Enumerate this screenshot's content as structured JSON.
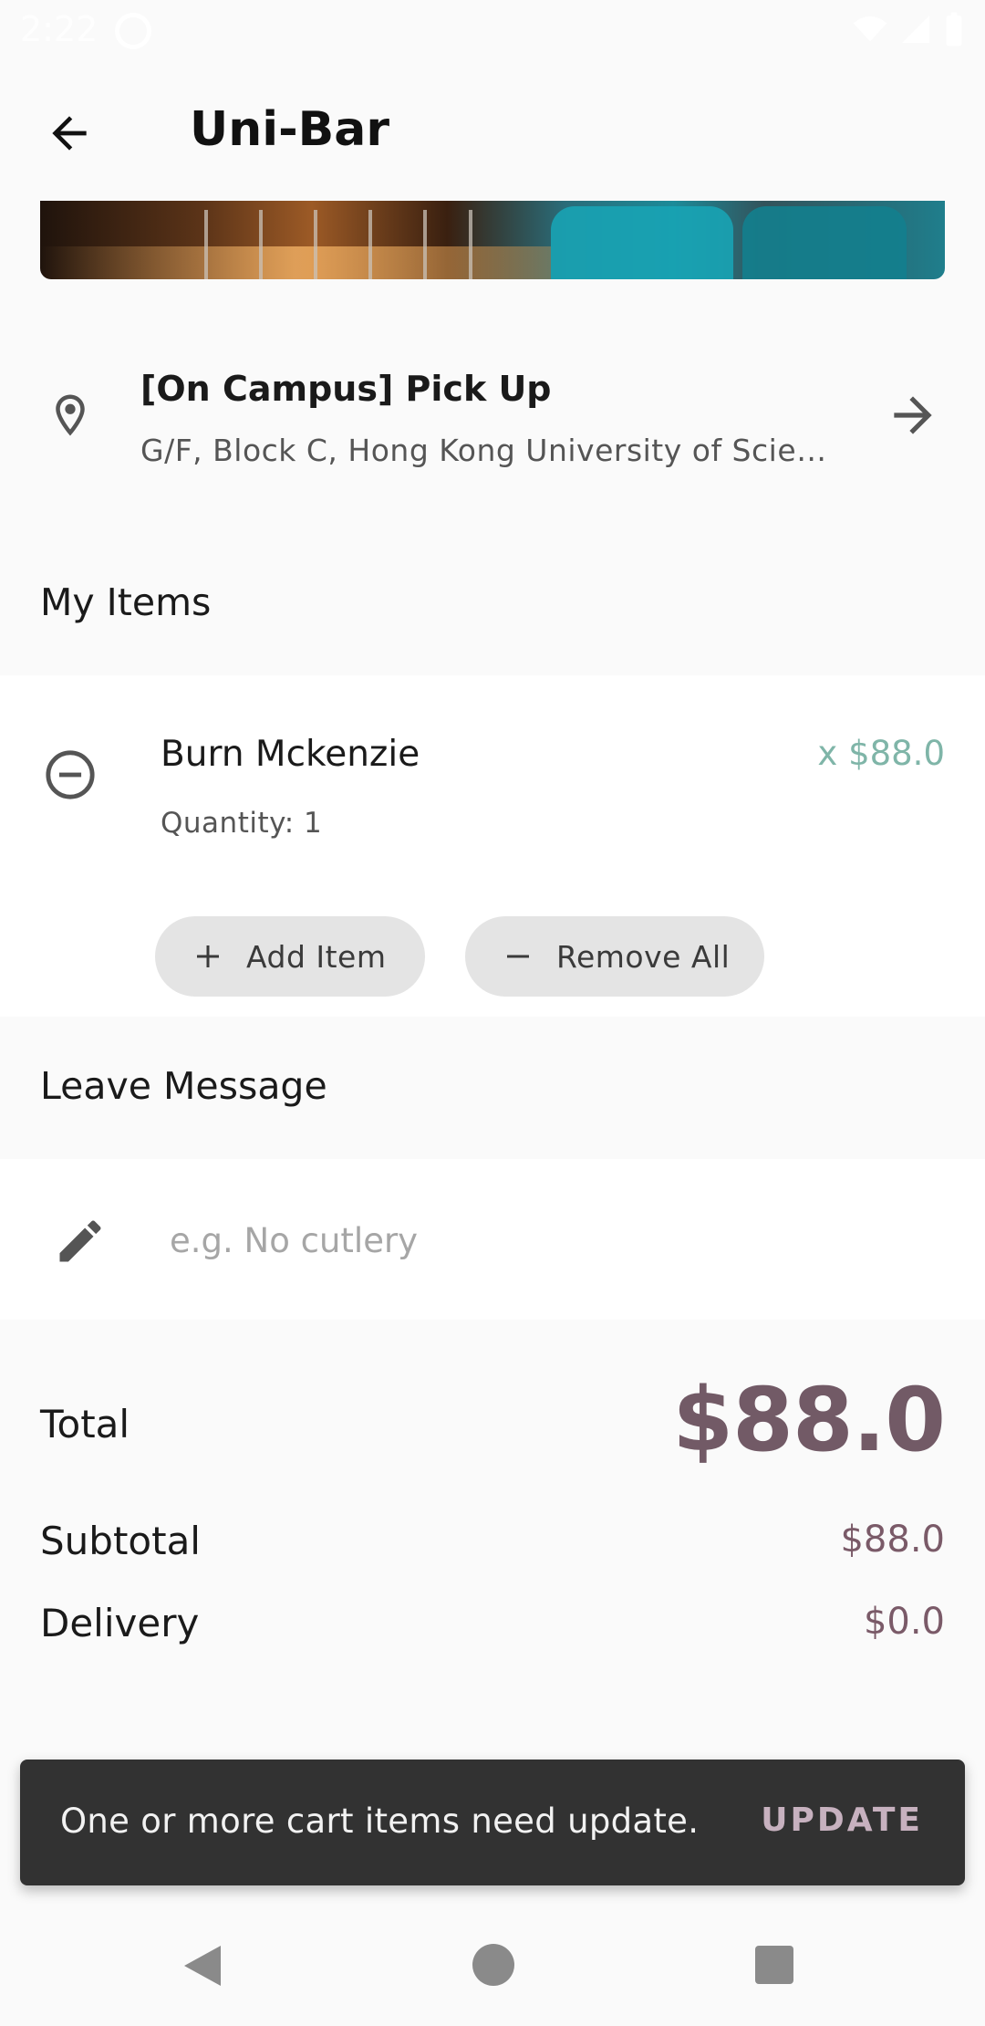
{
  "status_bar": {
    "time": "2:22"
  },
  "app_bar": {
    "title": "Uni-Bar"
  },
  "pickup": {
    "title": "[On Campus] Pick Up",
    "address": "G/F, Block C, Hong Kong University of Scien..."
  },
  "sections": {
    "items_title": "My Items",
    "message_title": "Leave Message"
  },
  "cart": {
    "items": [
      {
        "name": "Burn Mckenzie",
        "price": "x $88.0",
        "quantity": "Quantity: 1"
      }
    ],
    "add_item_label": "Add Item",
    "remove_all_label": "Remove All"
  },
  "message": {
    "placeholder": "e.g. No cutlery",
    "value": ""
  },
  "totals": {
    "total_label": "Total",
    "total_value": "$88.0",
    "subtotal_label": "Subtotal",
    "subtotal_value": "$88.0",
    "delivery_label": "Delivery",
    "delivery_value": "$0.0"
  },
  "snackbar": {
    "message": "One or more cart items need update.",
    "action": "UPDATE"
  },
  "colors": {
    "price_accent": "#7fb5a8",
    "total_accent": "#725a66",
    "snackbar_action": "#c7b1bf"
  },
  "icons": {
    "back": "arrow-left-icon",
    "location": "location-pin-icon",
    "forward": "arrow-right-icon",
    "remove_item": "minus-circle-icon",
    "add": "plus-icon",
    "remove": "minus-icon",
    "message": "pencil-icon"
  }
}
